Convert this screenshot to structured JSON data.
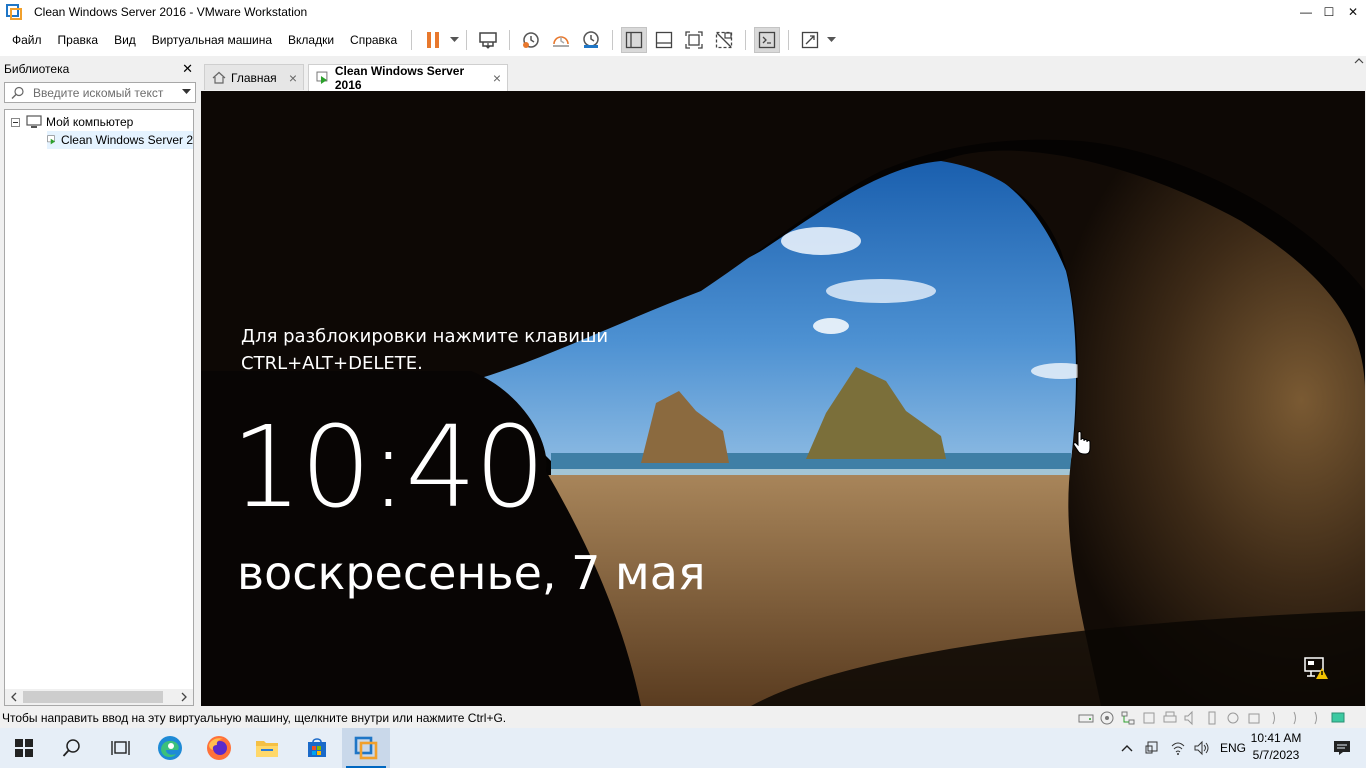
{
  "window": {
    "title": "Clean Windows Server 2016 - VMware Workstation",
    "minimize": "—",
    "maximize": "☐",
    "close": "✕"
  },
  "menu": [
    "Файл",
    "Правка",
    "Вид",
    "Виртуальная машина",
    "Вкладки",
    "Справка"
  ],
  "toolbar": {
    "pause_color": "#e8782d",
    "buttons": [
      "pause",
      "send-ctrl-alt-del",
      "snapshot",
      "revert-snapshot",
      "snapshot-manager",
      "library-view",
      "thumbnail-view",
      "fullscreen",
      "unity",
      "console",
      "stretch"
    ]
  },
  "library": {
    "title": "Библиотека",
    "close": "✕",
    "search_placeholder": "Введите искомый текст",
    "tree": {
      "root": "Мой компьютер",
      "child": "Clean Windows Server 2"
    }
  },
  "tabs": [
    {
      "label": "Главная",
      "icon": "home-icon",
      "active": false
    },
    {
      "label": "Clean Windows Server 2016",
      "icon": "vm-icon",
      "active": true
    }
  ],
  "vm": {
    "unlock_line1": "Для разблокировки нажмите клавиши",
    "unlock_line2": "CTRL+ALT+DELETE.",
    "time": "10:40",
    "date": "воскресенье, 7 мая"
  },
  "status": {
    "message": "Чтобы направить ввод на эту виртуальную машину, щелкните внутри или нажмите Ctrl+G."
  },
  "taskbar": {
    "apps": [
      "start-icon",
      "search-icon",
      "task-view-icon",
      "edge-icon",
      "firefox-icon",
      "file-explorer-icon",
      "store-icon",
      "vmware-icon"
    ],
    "language": "ENG",
    "time": "10:41 AM",
    "date": "5/7/2023"
  }
}
